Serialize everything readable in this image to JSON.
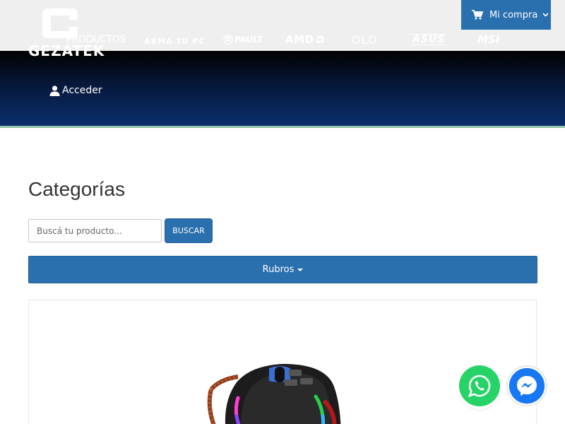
{
  "brand": {
    "logo_text": "GEZATEK"
  },
  "nav": {
    "items": [
      {
        "label": "PRODUCTOS"
      },
      {
        "label": "ARMA TU PC"
      },
      {
        "label": "PAULT"
      },
      {
        "label": "AMD"
      },
      {
        "label": "OLO"
      },
      {
        "label": "ASUS"
      },
      {
        "label": "MSI"
      }
    ]
  },
  "cart": {
    "label": "Mi compra",
    "icon": "cart-icon"
  },
  "account": {
    "label": "Acceder",
    "icon": "user-icon"
  },
  "main": {
    "title": "Categorías",
    "search": {
      "placeholder": "Buscá tu producto...",
      "value": "",
      "button_label": "BUSCAR"
    },
    "rubros_label": "Rubros"
  },
  "floating": {
    "whatsapp_icon": "whatsapp-icon",
    "messenger_icon": "messenger-icon"
  },
  "colors": {
    "primary": "#2a6fae",
    "header_dark": "#06183a",
    "header_blue": "#0b2e6e",
    "whatsapp": "#25d366",
    "messenger": "#1877f2"
  }
}
